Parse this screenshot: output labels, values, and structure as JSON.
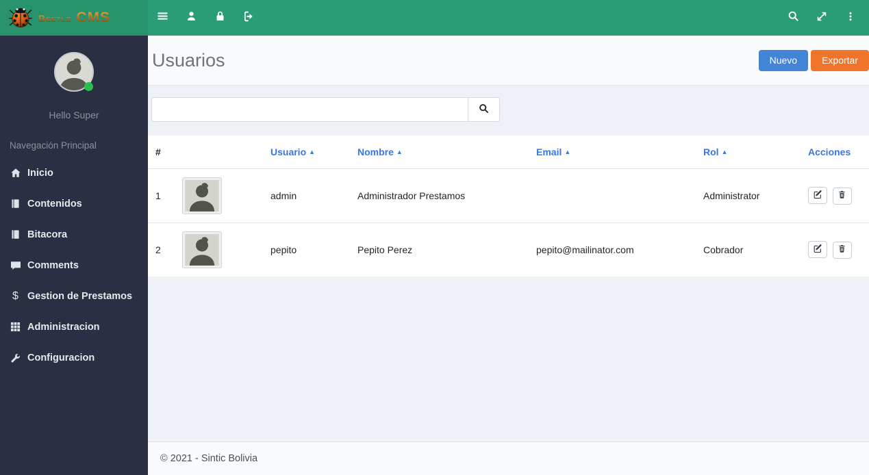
{
  "brand": {
    "name_primary": "Beetle",
    "name_secondary": "CMS"
  },
  "sidebar": {
    "greeting": "Hello Super",
    "section_label": "Navegación Principal",
    "items": [
      {
        "label": "Inicio",
        "icon": "home-icon"
      },
      {
        "label": "Contenidos",
        "icon": "book-icon"
      },
      {
        "label": "Bitacora",
        "icon": "book-icon"
      },
      {
        "label": "Comments",
        "icon": "comment-icon"
      },
      {
        "label": "Gestion de Prestamos",
        "icon": "dollar-icon"
      },
      {
        "label": "Administracion",
        "icon": "grid-icon"
      },
      {
        "label": "Configuracion",
        "icon": "wrench-icon"
      }
    ]
  },
  "page": {
    "title": "Usuarios",
    "actions": {
      "new_label": "Nuevo",
      "export_label": "Exportar"
    },
    "search": {
      "value": "",
      "placeholder": ""
    }
  },
  "table": {
    "headers": {
      "num": "#",
      "avatar": "",
      "usuario": "Usuario",
      "nombre": "Nombre",
      "email": "Email",
      "rol": "Rol",
      "acciones": "Acciones"
    },
    "sort_indicator": "▲",
    "rows": [
      {
        "num": "1",
        "usuario": "admin",
        "nombre": "Administrador Prestamos",
        "email": "",
        "rol": "Administrator"
      },
      {
        "num": "2",
        "usuario": "pepito",
        "nombre": "Pepito Perez",
        "email": "pepito@mailinator.com",
        "rol": "Cobrador"
      }
    ]
  },
  "footer": {
    "copyright": "© 2021 - Sintic Bolivia"
  },
  "colors": {
    "navbar-green": "#2a9d77",
    "brand-green": "#27926b",
    "sidebar-navy": "#2b2f43",
    "content-bg": "#eef2f7",
    "header-bg": "#f8fafc",
    "primary-blue": "#4285d6",
    "export-orange": "#f0752b",
    "link-blue": "#3d76d8",
    "footer-bg": "#fafbfd"
  }
}
